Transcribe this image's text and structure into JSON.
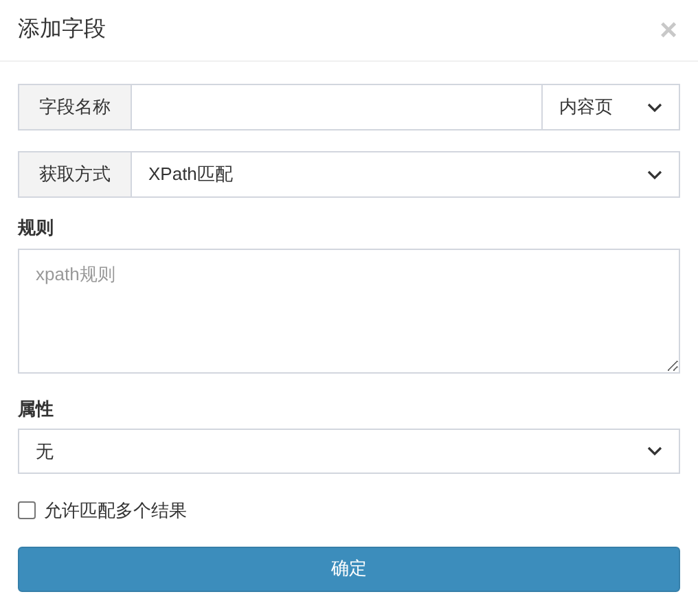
{
  "dialog": {
    "title": "添加字段",
    "close": "×"
  },
  "name_row": {
    "label": "字段名称",
    "select": "内容页"
  },
  "method_row": {
    "label": "获取方式",
    "select": "XPath匹配"
  },
  "rule": {
    "label": "规则",
    "placeholder": "xpath规则"
  },
  "attribute": {
    "label": "属性",
    "select": "无"
  },
  "multiple": {
    "label": "允许匹配多个结果",
    "checked": false
  },
  "submit": "确定"
}
